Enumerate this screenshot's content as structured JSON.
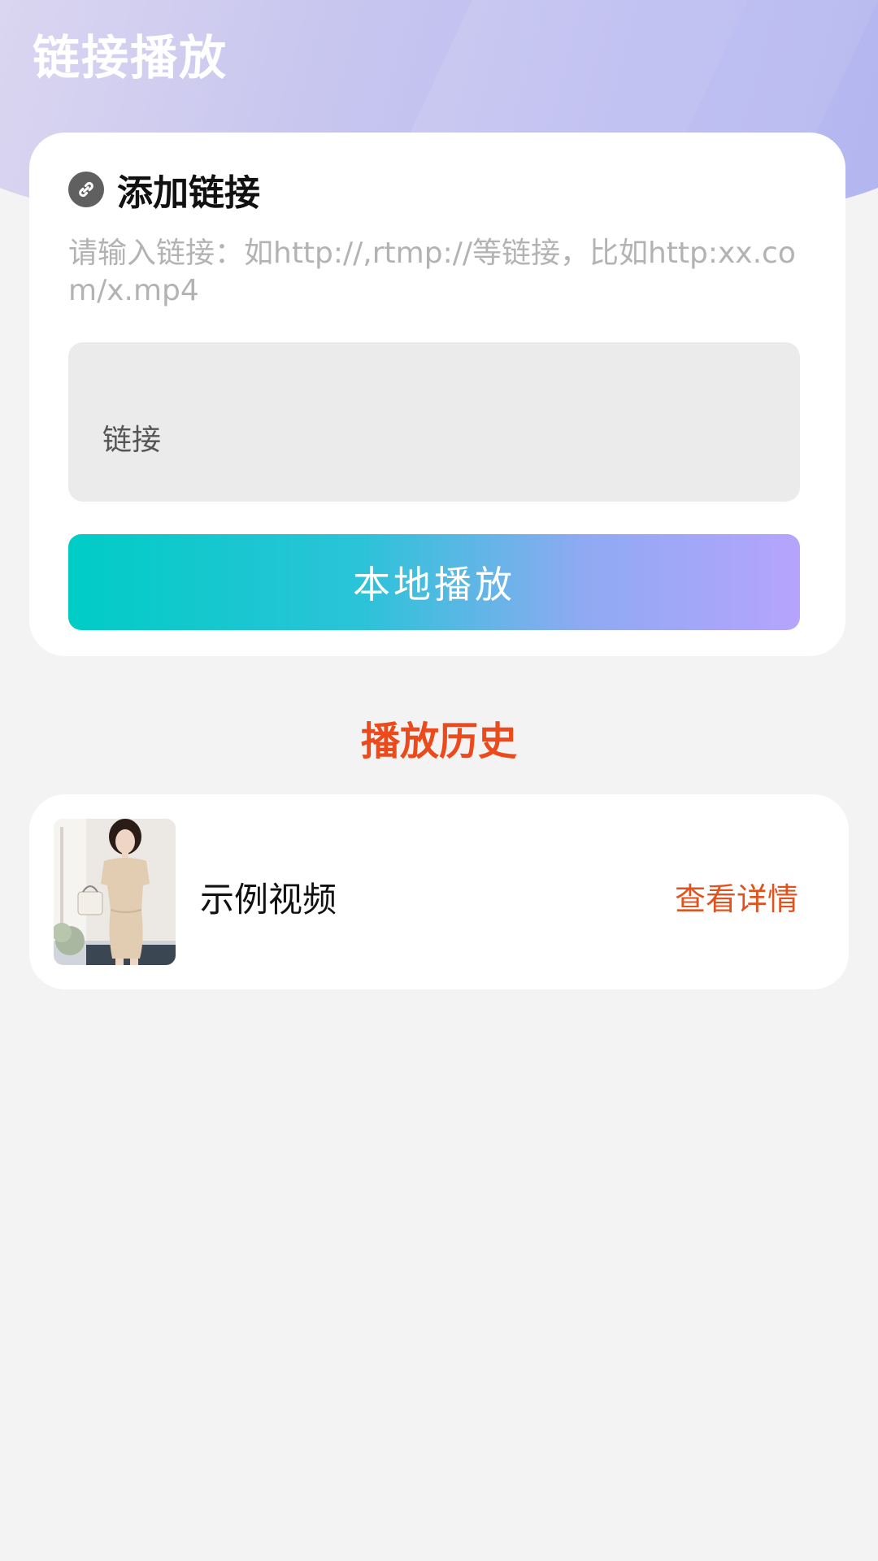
{
  "header": {
    "title": "链接播放"
  },
  "add_link": {
    "title": "添加链接",
    "icon": "link-icon",
    "hint": "请输入链接：如http://,rtmp://等链接，比如http:xx.com/x.mp4",
    "input_placeholder": "链接",
    "input_value": "",
    "button_label": "本地播放"
  },
  "history": {
    "title": "播放历史",
    "items": [
      {
        "title": "示例视频",
        "action": "查看详情"
      }
    ]
  },
  "colors": {
    "accent_orange": "#ec4a1a",
    "button_gradient_start": "#00ccc6",
    "button_gradient_end": "#b6a4fd",
    "header_gradient": "#c9c7ef"
  }
}
